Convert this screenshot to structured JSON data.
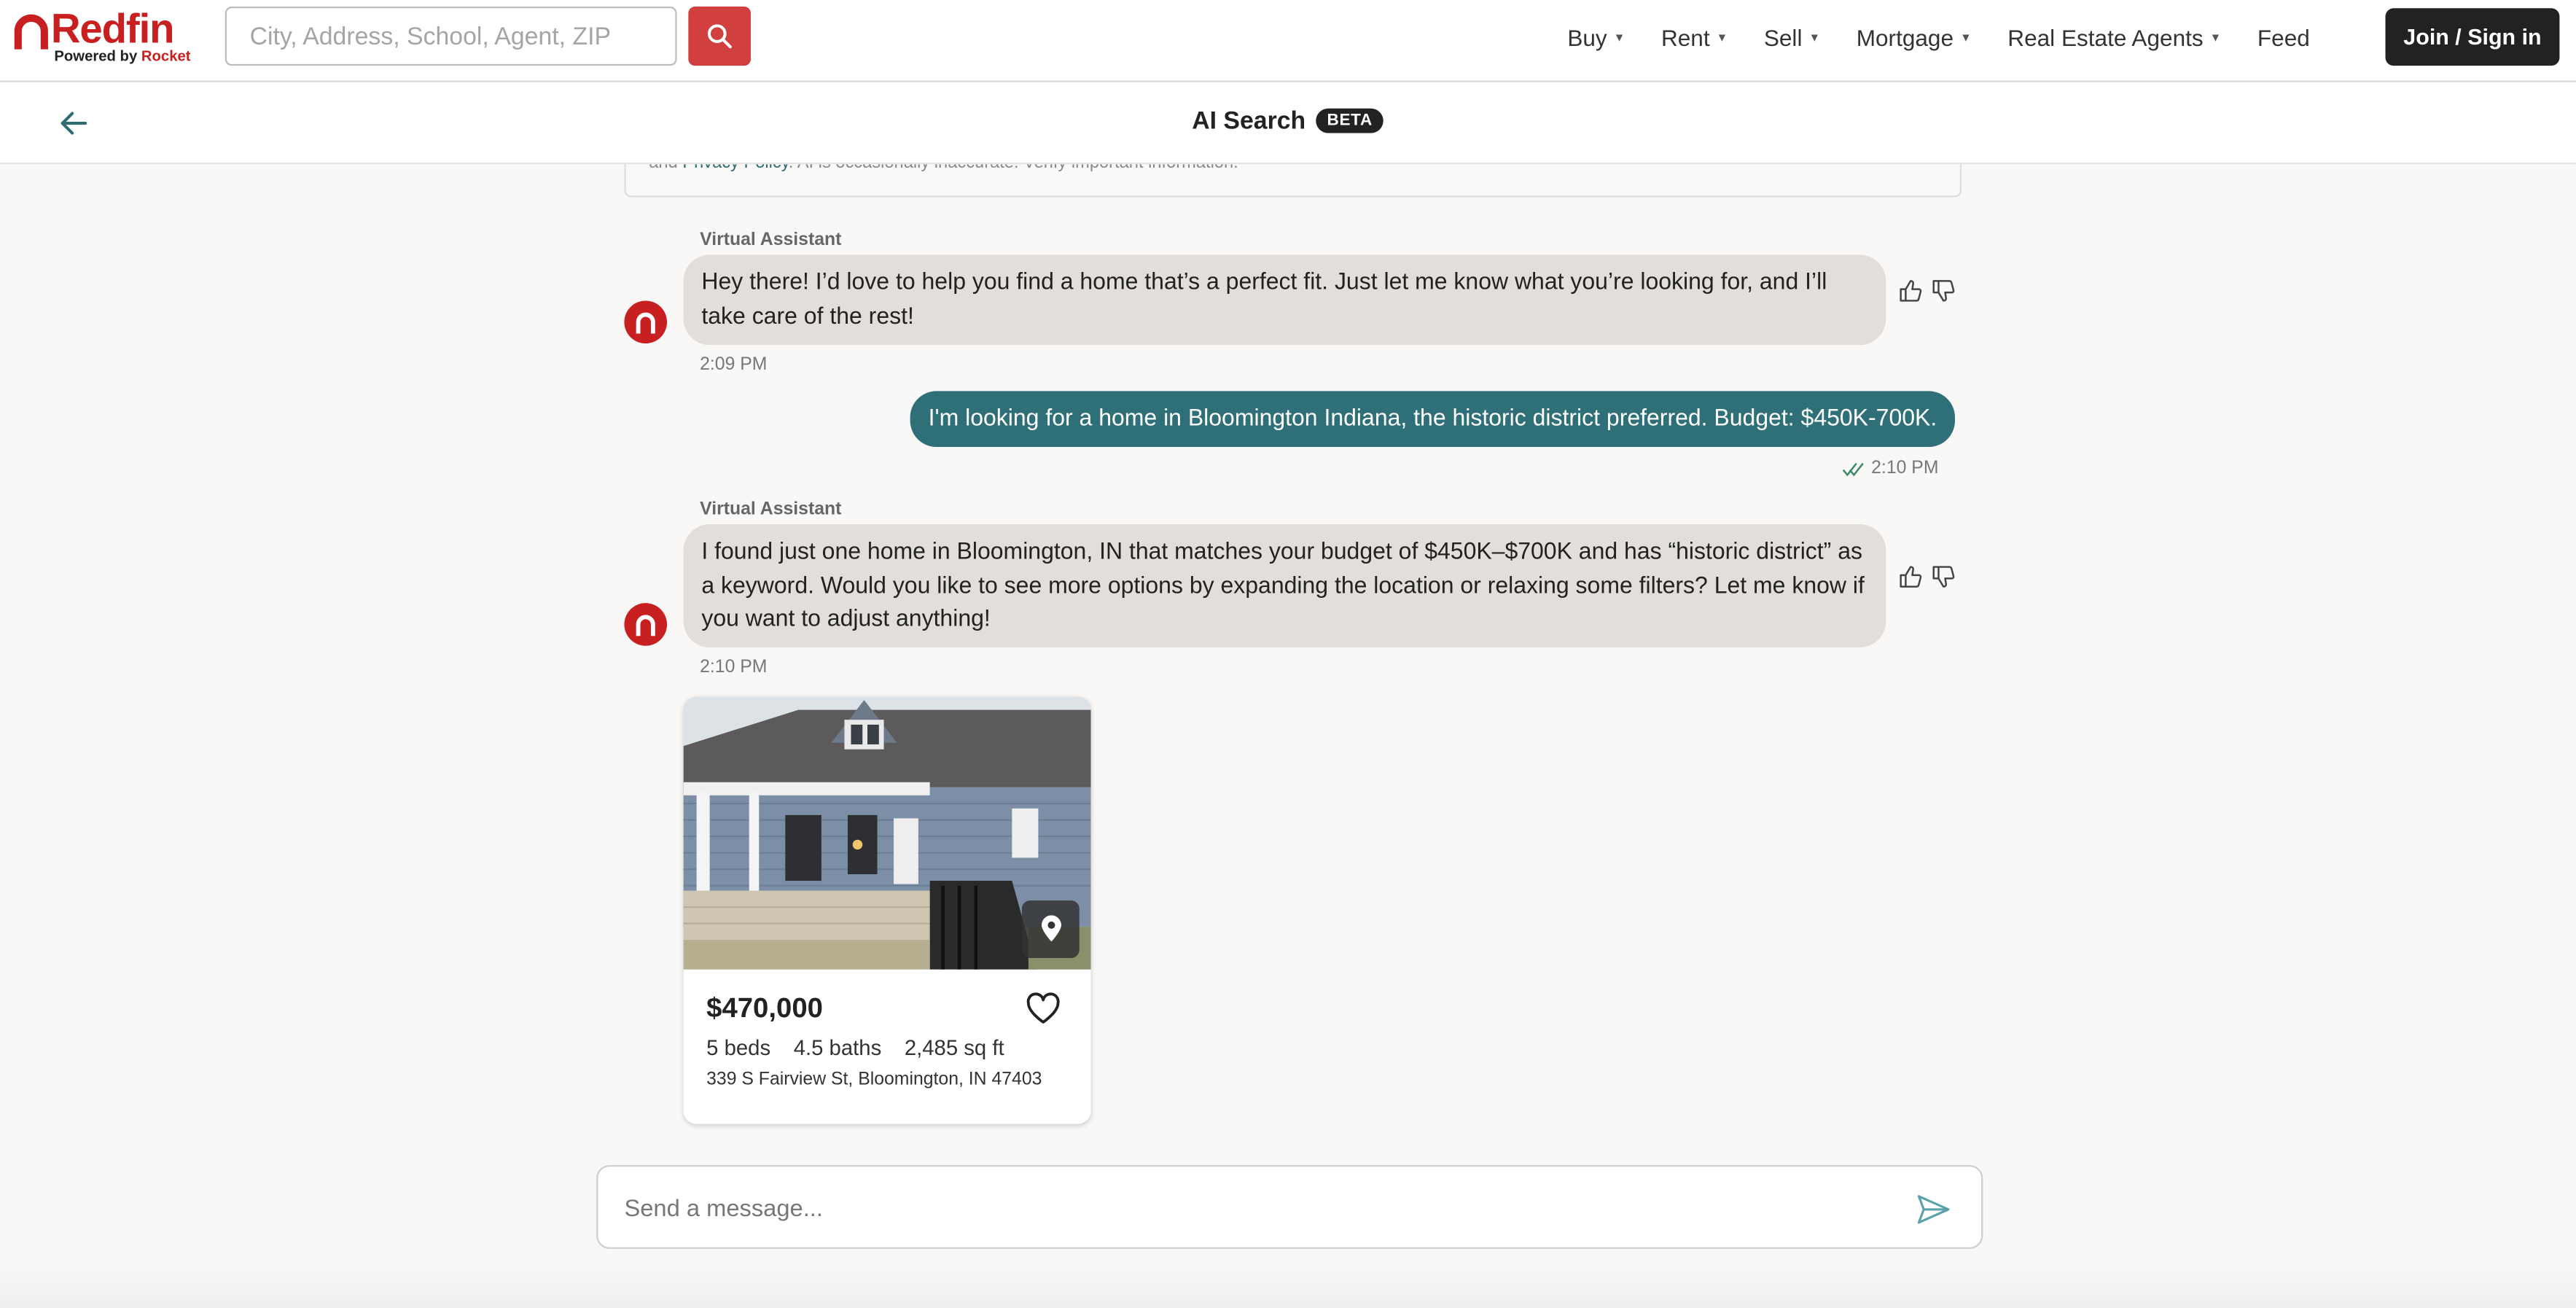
{
  "header": {
    "logo_text": "Redfin",
    "logo_sub_prefix": "Powered by",
    "logo_sub_brand": "Rocket",
    "search_placeholder": "City, Address, School, Agent, ZIP",
    "nav": [
      {
        "label": "Buy",
        "has_caret": true
      },
      {
        "label": "Rent",
        "has_caret": true
      },
      {
        "label": "Sell",
        "has_caret": true
      },
      {
        "label": "Mortgage",
        "has_caret": true
      },
      {
        "label": "Real Estate Agents",
        "has_caret": true
      },
      {
        "label": "Feed",
        "has_caret": false
      }
    ],
    "join_label": "Join / Sign in",
    "brand_color": "#c82021"
  },
  "subheader": {
    "title": "AI Search",
    "badge": "BETA"
  },
  "disclaimer": {
    "prefix": "and ",
    "link": "Privacy Policy",
    "suffix": ". AI is occasionally inaccurate. Verify important information."
  },
  "messages": [
    {
      "role": "assistant",
      "sender": "Virtual Assistant",
      "text": "Hey there! I’d love to help you find a home that’s a perfect fit. Just let me know what you’re looking for, and I’ll take care of the rest!",
      "time": "2:09 PM"
    },
    {
      "role": "user",
      "text": "I'm looking for a home in Bloomington Indiana, the historic district preferred. Budget: $450K-700K.",
      "time": "2:10 PM",
      "read": true
    },
    {
      "role": "assistant",
      "sender": "Virtual Assistant",
      "text": "I found just one home in Bloomington, IN that matches your budget of $450K–$700K and has “historic district” as a keyword. Would you like to see more options by expanding the location or relaxing some filters? Let me know if you want to adjust anything!",
      "time": "2:10 PM"
    }
  ],
  "listing": {
    "price": "$470,000",
    "beds": "5 beds",
    "baths": "4.5 baths",
    "sqft": "2,485 sq ft",
    "address": "339 S Fairview St, Bloomington, IN 47403"
  },
  "composer": {
    "placeholder": "Send a message..."
  },
  "colors": {
    "user_bubble": "#2e6f78",
    "assistant_bubble": "#e2deda"
  }
}
